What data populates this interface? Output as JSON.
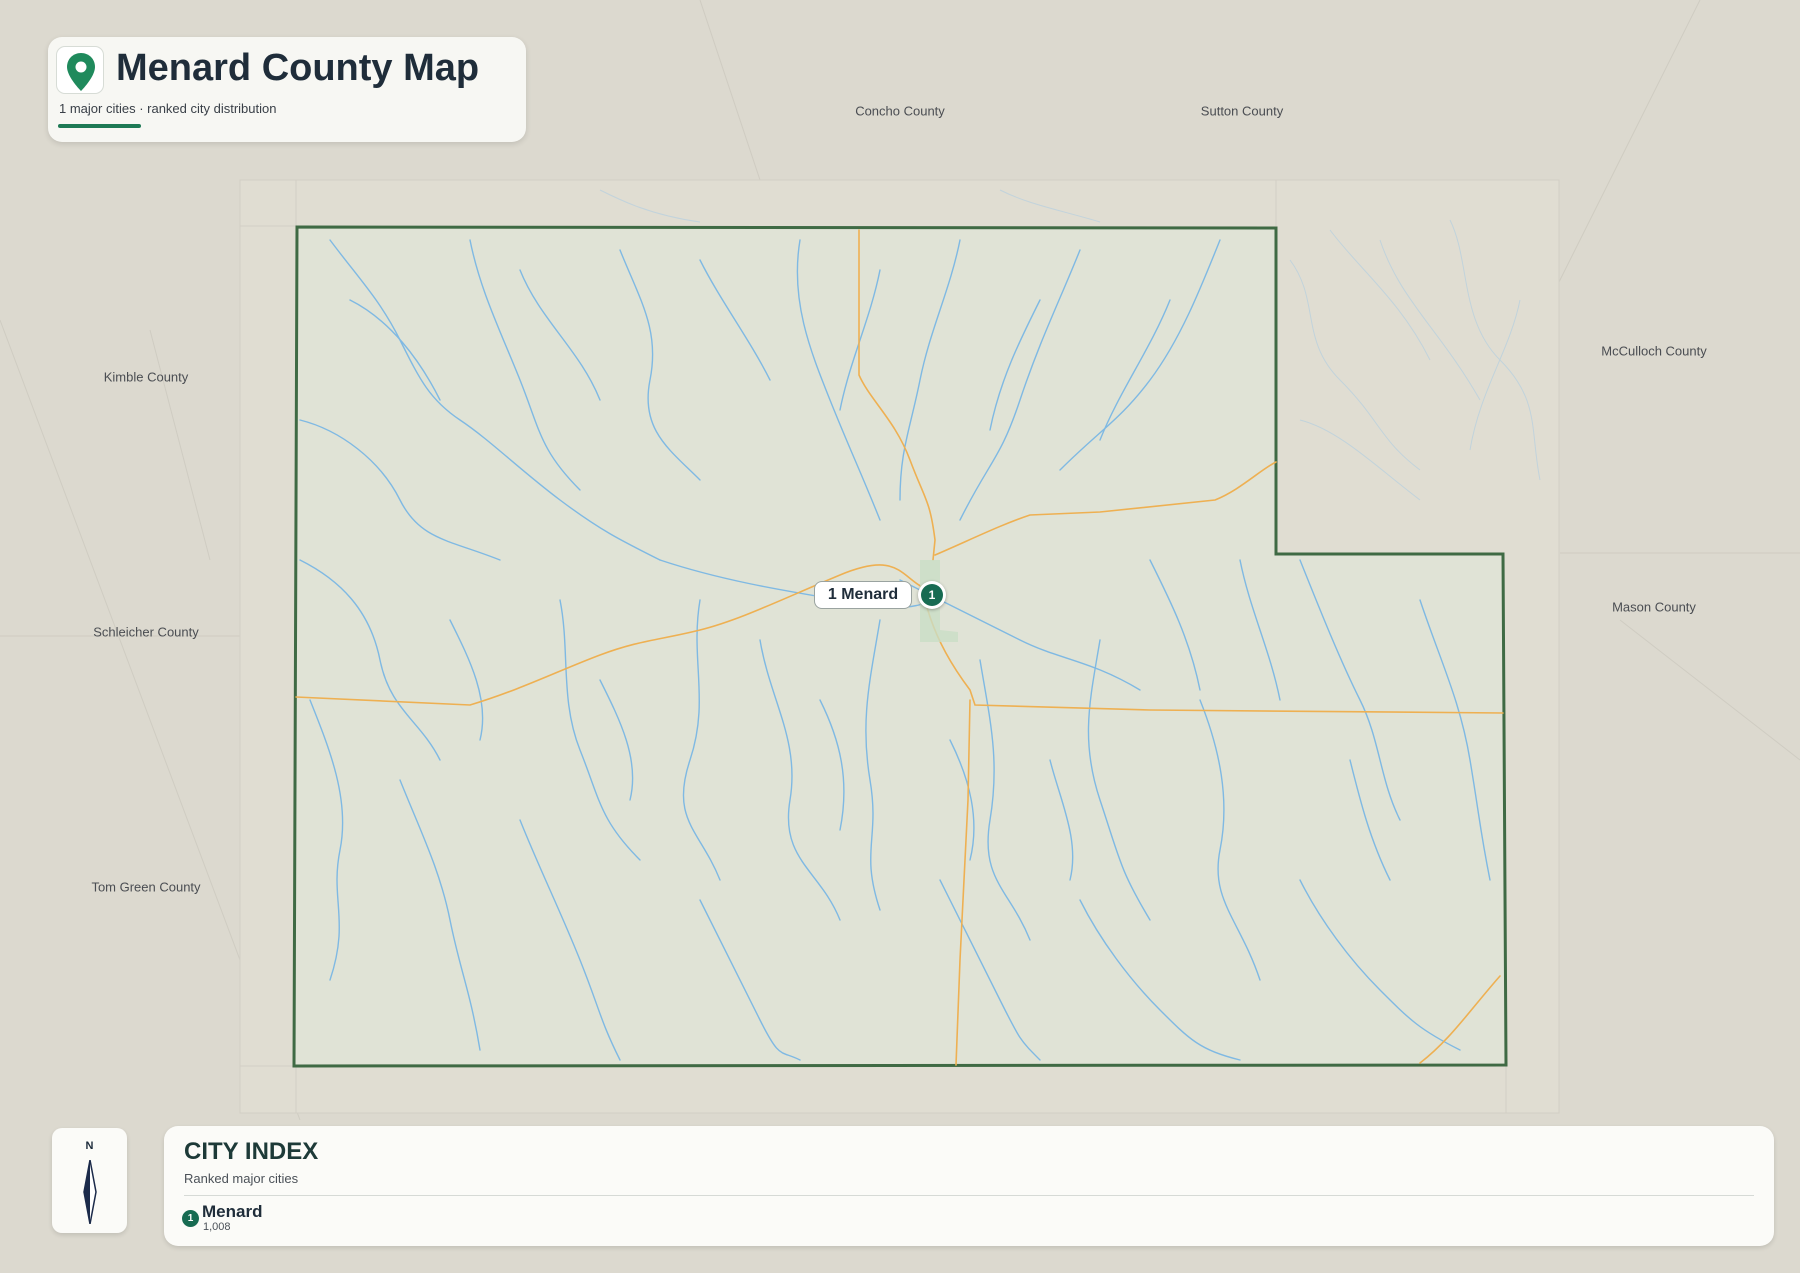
{
  "header": {
    "title": "Menard County Map",
    "subtitle": "1 major cities · ranked city distribution",
    "icon": "map-pin-icon"
  },
  "neighbors": [
    {
      "id": "concho",
      "name": "Concho County"
    },
    {
      "id": "sutton",
      "name": "Sutton County"
    },
    {
      "id": "kimble",
      "name": "Kimble County"
    },
    {
      "id": "mcculloch",
      "name": "McCulloch County"
    },
    {
      "id": "schleicher",
      "name": "Schleicher County"
    },
    {
      "id": "mason",
      "name": "Mason County"
    },
    {
      "id": "tomgreen",
      "name": "Tom Green County"
    }
  ],
  "cities": [
    {
      "rank": "1",
      "name": "Menard",
      "callout": "1 Menard",
      "population": "1,008"
    }
  ],
  "compass": {
    "label": "N",
    "icon": "compass-needle-icon"
  },
  "index": {
    "title": "CITY INDEX",
    "subtitle": "Ranked major cities"
  },
  "colors": {
    "accent": "#176b52",
    "county_border": "#3f6a44",
    "county_fill": "#e0e3d6",
    "rivers": "#7fb9e3",
    "roads": "#eeb052",
    "background": "#dcd9cf"
  }
}
